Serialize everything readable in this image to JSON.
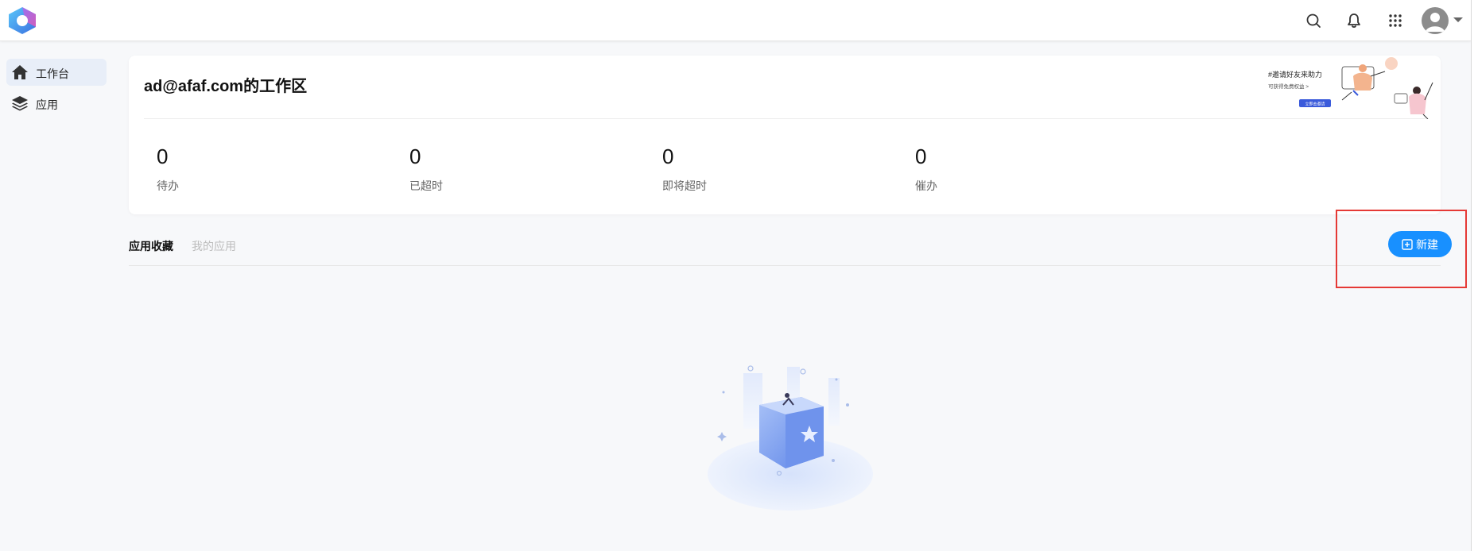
{
  "header": {
    "icons": [
      "app-logo",
      "search-icon",
      "bell-icon",
      "apps-grid-icon",
      "user-avatar",
      "caret-down-icon"
    ]
  },
  "sidebar": {
    "items": [
      {
        "label": "工作台",
        "icon": "home-icon",
        "active": true
      },
      {
        "label": "应用",
        "icon": "layers-icon",
        "active": false
      }
    ]
  },
  "workspace": {
    "title": "ad@afaf.com的工作区",
    "stats": [
      {
        "value": "0",
        "label": "待办"
      },
      {
        "value": "0",
        "label": "已超时"
      },
      {
        "value": "0",
        "label": "即将超时"
      },
      {
        "value": "0",
        "label": "催办"
      }
    ],
    "banner": {
      "headline": "#邀请好友来助力",
      "sub": "可获得免费权益 >",
      "button": "立即去邀请"
    }
  },
  "tabs": [
    {
      "label": "应用收藏",
      "active": true
    },
    {
      "label": "我的应用",
      "active": false
    }
  ],
  "toolbar": {
    "new_label": "新建"
  },
  "colors": {
    "accent": "#1890ff",
    "annotation": "#e53935",
    "background": "#f7f8fa"
  }
}
